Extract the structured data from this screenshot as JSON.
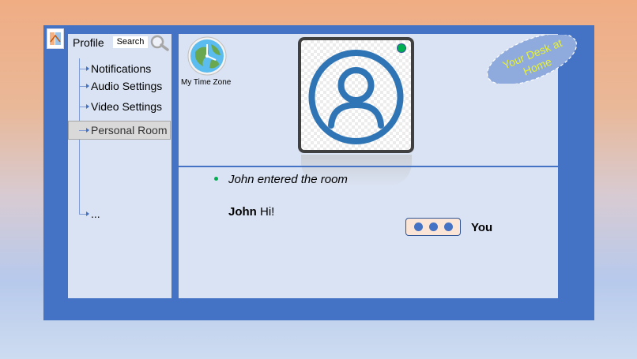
{
  "sidebar": {
    "profile_label": "Profile",
    "search_label": "Search",
    "items": [
      {
        "label": "Notifications"
      },
      {
        "label": "Audio Settings"
      },
      {
        "label": "Video Settings"
      },
      {
        "label": "Personal Room",
        "selected": true
      },
      {
        "label": "..."
      }
    ]
  },
  "main": {
    "timezone_label": "My Time Zone",
    "desk_badge": {
      "line1": "Your Desk at",
      "line2": "Home"
    },
    "video": {
      "online": true,
      "status_color": "#00b050"
    },
    "chat": {
      "system_message": "John entered the room",
      "messages": [
        {
          "sender": "John",
          "text": " Hi!"
        }
      ],
      "typing_user": "You"
    }
  },
  "colors": {
    "window": "#4472c4",
    "panel": "#dae3f3",
    "avatar": "#2f75b5",
    "badge_text": "#e8f22a",
    "typing_bubble": "#fbe5d6"
  },
  "icons": [
    "app-icon",
    "search-icon",
    "globe-clock-icon",
    "user-avatar-icon",
    "typing-dots-icon"
  ]
}
